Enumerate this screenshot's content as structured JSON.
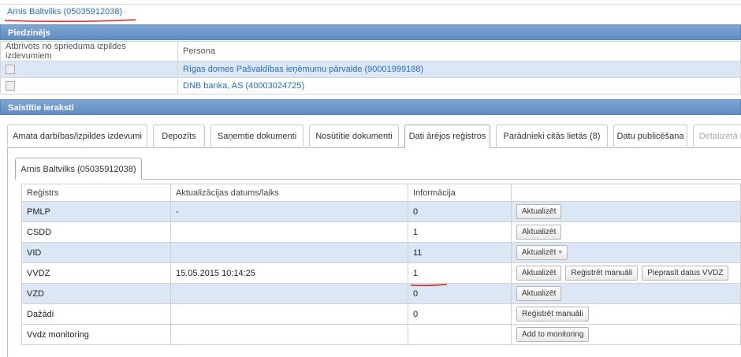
{
  "person_link": "Arnis Baltvilks (05035912038)",
  "piedzinejs": {
    "title": "Piedzinējs",
    "headers": [
      "Atbrīvots no sprieduma izpildes izdevumiem",
      "Persona"
    ],
    "rows": [
      {
        "persona": "Rīgas domes Pašvaldības ieņēmumu pārvalde (90001999188)"
      },
      {
        "persona": "DNB banka, AS (40003024725)"
      }
    ]
  },
  "saistitie": {
    "title": "Saistītie ieraksti",
    "tabs": [
      "Amata darbības/izpildes izdevumi",
      "Depozīts",
      "Saņemtie dokumenti",
      "Nosūtītie dokumenti",
      "Dati ārējos reģistros",
      "Parādnieki citās lietās (8)",
      "Datu publicēšana",
      "Detalizētā i"
    ],
    "active_tab": "Dati ārējos reģistros",
    "subtab": "Arnis Baltvilks (05035912038)"
  },
  "registers": {
    "headers": [
      "Reģistrs",
      "Aktualizācijas datums/laiks",
      "Informācija",
      ""
    ],
    "rows": [
      {
        "registrs": "PMLP",
        "datums": "-",
        "info": "0",
        "buttons": [
          "Aktualizēt"
        ]
      },
      {
        "registrs": "CSDD",
        "datums": "",
        "info": "1",
        "buttons": [
          "Aktualizēt"
        ]
      },
      {
        "registrs": "VID",
        "datums": "",
        "info": "11",
        "buttons": [
          "Aktualizēt"
        ]
      },
      {
        "registrs": "VVDZ",
        "datums": "15.05.2015 10:14:25",
        "info": "1",
        "buttons": [
          "Aktualizēt",
          "Reģistrēt manuāli",
          "Pieprasīt datus VVDZ"
        ]
      },
      {
        "registrs": "VZD",
        "datums": "",
        "info": "0",
        "buttons": [
          "Aktualizēt"
        ]
      },
      {
        "registrs": "Dažādi",
        "datums": "",
        "info": "0",
        "buttons": [
          "Reģistrēt manuāli"
        ]
      },
      {
        "registrs": "Vvdz monitoring",
        "datums": "",
        "info": "",
        "buttons": [
          "Add to monitoring"
        ]
      }
    ]
  },
  "colors": {
    "header": "#6e99cb",
    "alt_row": "#dbe7f5",
    "link": "#2a6ebb",
    "annotation": "#d22"
  }
}
